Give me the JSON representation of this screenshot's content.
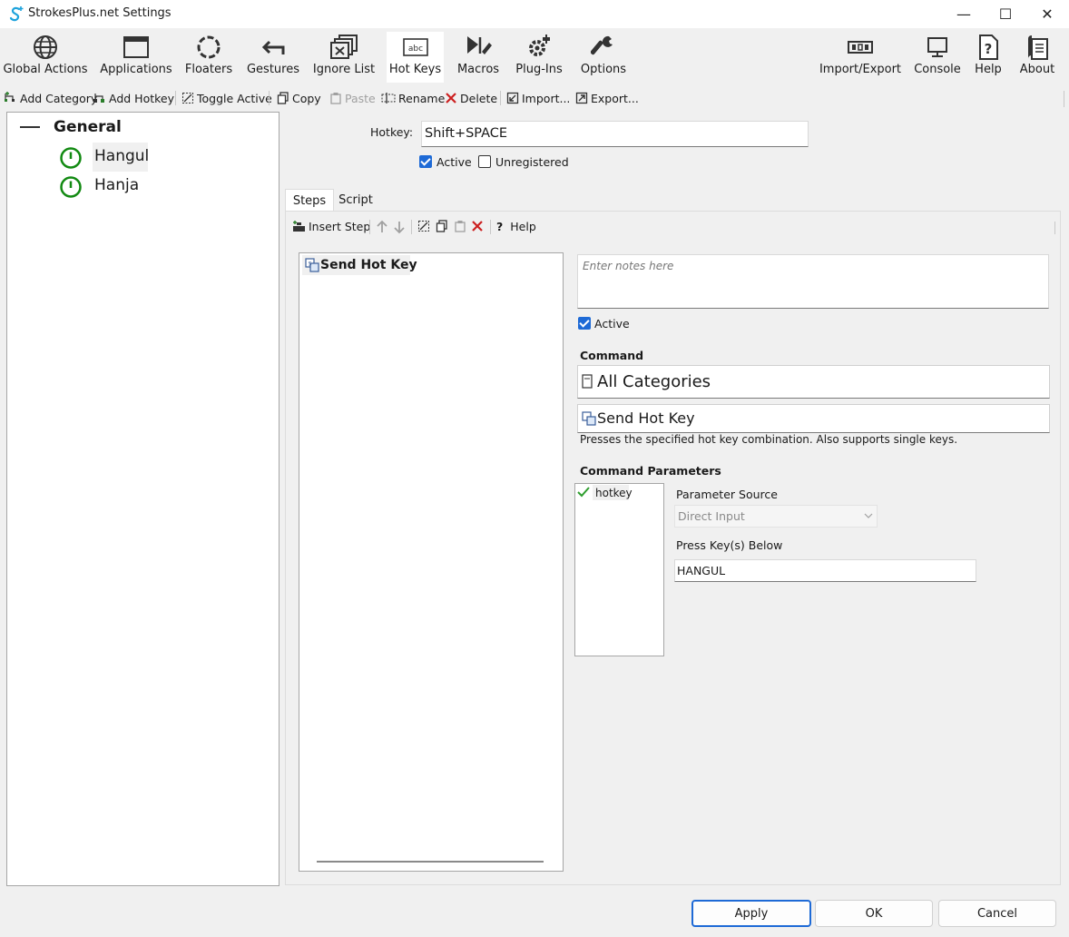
{
  "window": {
    "title": "StrokesPlus.net Settings",
    "minimize": "—",
    "maximize": "☐",
    "close": "✕"
  },
  "ribbon": {
    "global_actions": "Global Actions",
    "applications": "Applications",
    "floaters": "Floaters",
    "gestures": "Gestures",
    "ignore_list": "Ignore List",
    "hot_keys": "Hot Keys",
    "macros": "Macros",
    "plugins": "Plug-Ins",
    "options": "Options",
    "import_export": "Import/Export",
    "console": "Console",
    "help": "Help",
    "about": "About",
    "selected": "Hot Keys"
  },
  "toolbar": {
    "add_category": "Add Category",
    "add_hotkey": "Add Hotkey",
    "toggle_active": "Toggle Active",
    "copy": "Copy",
    "paste": "Paste",
    "rename": "Rename",
    "delete": "Delete",
    "import": "Import...",
    "export": "Export..."
  },
  "tree": {
    "category": "General",
    "items": [
      {
        "label": "Hangul",
        "selected": true
      },
      {
        "label": "Hanja",
        "selected": false
      }
    ]
  },
  "hotkey": {
    "label": "Hotkey:",
    "value": "Shift+SPACE",
    "active_label": "Active",
    "active": true,
    "unregistered_label": "Unregistered",
    "unregistered": false
  },
  "tabs": {
    "steps": "Steps",
    "script": "Script",
    "selected": "Steps"
  },
  "steps_toolbar": {
    "insert_step": "Insert Step",
    "help": "Help"
  },
  "steps": [
    {
      "label": "Send Hot Key"
    }
  ],
  "step_detail": {
    "notes_placeholder": "Enter notes here",
    "active_label": "Active",
    "active": true,
    "command_heading": "Command",
    "category": "All Categories",
    "command": "Send Hot Key",
    "command_description": "Presses the specified hot key combination. Also supports single keys.",
    "params_heading": "Command Parameters",
    "params": [
      {
        "label": "hotkey",
        "checked": true
      }
    ],
    "param_source_label": "Parameter Source",
    "param_source_value": "Direct Input",
    "press_keys_label": "Press Key(s) Below",
    "press_keys_value": "HANGUL"
  },
  "buttons": {
    "apply": "Apply",
    "ok": "OK",
    "cancel": "Cancel"
  },
  "colors": {
    "accent": "#1e6ad6",
    "active_green": "#128a12",
    "delete_red": "#cc1f1f",
    "check_green": "#2e9e2e"
  }
}
